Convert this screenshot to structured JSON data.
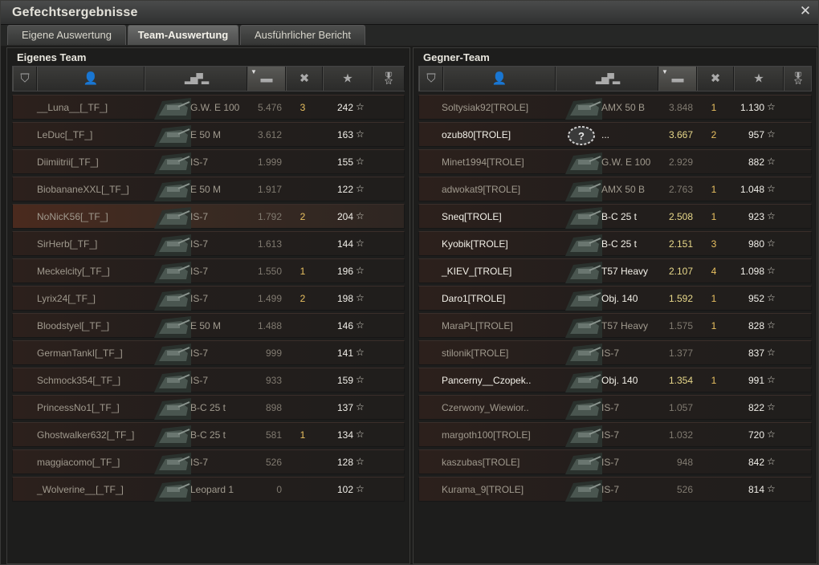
{
  "window": {
    "title": "Gefechtsergebnisse",
    "close_glyph": "✕"
  },
  "tabs": [
    {
      "label": "Eigene Auswertung",
      "active": false
    },
    {
      "label": "Team-Auswertung",
      "active": true
    },
    {
      "label": "Ausführlicher Bericht",
      "active": false
    }
  ],
  "left": {
    "title": "Eigenes Team",
    "rows": [
      {
        "player": "__Luna__[_TF_]",
        "vehicle": "G.W. E 100",
        "damage": "5.476",
        "frags": "3",
        "xp": "242",
        "alive": false,
        "hl": false
      },
      {
        "player": "LeDuc[_TF_]",
        "vehicle": "E 50 M",
        "damage": "3.612",
        "frags": "",
        "xp": "163",
        "alive": false,
        "hl": false
      },
      {
        "player": "Diimiitrii[_TF_]",
        "vehicle": "IS-7",
        "damage": "1.999",
        "frags": "",
        "xp": "155",
        "alive": false,
        "hl": false
      },
      {
        "player": "BiobananeXXL[_TF_]",
        "vehicle": "E 50 M",
        "damage": "1.917",
        "frags": "",
        "xp": "122",
        "alive": false,
        "hl": false
      },
      {
        "player": "NoNicK56[_TF_]",
        "vehicle": "IS-7",
        "damage": "1.792",
        "frags": "2",
        "xp": "204",
        "alive": false,
        "hl": true
      },
      {
        "player": "SirHerb[_TF_]",
        "vehicle": "IS-7",
        "damage": "1.613",
        "frags": "",
        "xp": "144",
        "alive": false,
        "hl": false
      },
      {
        "player": "Meckelcity[_TF_]",
        "vehicle": "IS-7",
        "damage": "1.550",
        "frags": "1",
        "xp": "196",
        "alive": false,
        "hl": false
      },
      {
        "player": "Lyrix24[_TF_]",
        "vehicle": "IS-7",
        "damage": "1.499",
        "frags": "2",
        "xp": "198",
        "alive": false,
        "hl": false
      },
      {
        "player": "Bloodstyel[_TF_]",
        "vehicle": "E 50 M",
        "damage": "1.488",
        "frags": "",
        "xp": "146",
        "alive": false,
        "hl": false
      },
      {
        "player": "GermanTankI[_TF_]",
        "vehicle": "IS-7",
        "damage": "999",
        "frags": "",
        "xp": "141",
        "alive": false,
        "hl": false
      },
      {
        "player": "Schmock354[_TF_]",
        "vehicle": "IS-7",
        "damage": "933",
        "frags": "",
        "xp": "159",
        "alive": false,
        "hl": false
      },
      {
        "player": "PrincessNo1[_TF_]",
        "vehicle": "B-C 25 t",
        "damage": "898",
        "frags": "",
        "xp": "137",
        "alive": false,
        "hl": false
      },
      {
        "player": "Ghostwalker632[_TF_]",
        "vehicle": "B-C 25 t",
        "damage": "581",
        "frags": "1",
        "xp": "134",
        "alive": false,
        "hl": false
      },
      {
        "player": "maggiacomo[_TF_]",
        "vehicle": "IS-7",
        "damage": "526",
        "frags": "",
        "xp": "128",
        "alive": false,
        "hl": false
      },
      {
        "player": "_Wolverine__[_TF_]",
        "vehicle": "Leopard 1",
        "damage": "0",
        "frags": "",
        "xp": "102",
        "alive": false,
        "hl": false
      }
    ]
  },
  "right": {
    "title": "Gegner-Team",
    "rows": [
      {
        "player": "Soltysiak92[TROLE]",
        "vehicle": "AMX 50 B",
        "damage": "3.848",
        "frags": "1",
        "xp": "1.130",
        "alive": false,
        "hl": false
      },
      {
        "player": "ozub80[TROLE]",
        "vehicle": "...",
        "damage": "3.667",
        "frags": "2",
        "xp": "957",
        "alive": true,
        "hl": false,
        "unknown": true
      },
      {
        "player": "Minet1994[TROLE]",
        "vehicle": "G.W. E 100",
        "damage": "2.929",
        "frags": "",
        "xp": "882",
        "alive": false,
        "hl": false
      },
      {
        "player": "adwokat9[TROLE]",
        "vehicle": "AMX 50 B",
        "damage": "2.763",
        "frags": "1",
        "xp": "1.048",
        "alive": false,
        "hl": false
      },
      {
        "player": "Sneq[TROLE]",
        "vehicle": "B-C 25 t",
        "damage": "2.508",
        "frags": "1",
        "xp": "923",
        "alive": true,
        "hl": false
      },
      {
        "player": "Kyobik[TROLE]",
        "vehicle": "B-C 25 t",
        "damage": "2.151",
        "frags": "3",
        "xp": "980",
        "alive": true,
        "hl": false
      },
      {
        "player": "_KIEV_[TROLE]",
        "vehicle": "T57 Heavy",
        "damage": "2.107",
        "frags": "4",
        "xp": "1.098",
        "alive": true,
        "hl": false
      },
      {
        "player": "Daro1[TROLE]",
        "vehicle": "Obj. 140",
        "damage": "1.592",
        "frags": "1",
        "xp": "952",
        "alive": true,
        "hl": false
      },
      {
        "player": "MaraPL[TROLE]",
        "vehicle": "T57 Heavy",
        "damage": "1.575",
        "frags": "1",
        "xp": "828",
        "alive": false,
        "hl": false
      },
      {
        "player": "stilonik[TROLE]",
        "vehicle": "IS-7",
        "damage": "1.377",
        "frags": "",
        "xp": "837",
        "alive": false,
        "hl": false
      },
      {
        "player": "Pancerny__Czopek..",
        "vehicle": "Obj. 140",
        "damage": "1.354",
        "frags": "1",
        "xp": "991",
        "alive": true,
        "hl": false
      },
      {
        "player": "Czerwony_Wiewior..",
        "vehicle": "IS-7",
        "damage": "1.057",
        "frags": "",
        "xp": "822",
        "alive": false,
        "hl": false
      },
      {
        "player": "margoth100[TROLE]",
        "vehicle": "IS-7",
        "damage": "1.032",
        "frags": "",
        "xp": "720",
        "alive": false,
        "hl": false
      },
      {
        "player": "kaszubas[TROLE]",
        "vehicle": "IS-7",
        "damage": "948",
        "frags": "",
        "xp": "842",
        "alive": false,
        "hl": false
      },
      {
        "player": "Kurama_9[TROLE]",
        "vehicle": "IS-7",
        "damage": "526",
        "frags": "",
        "xp": "814",
        "alive": false,
        "hl": false
      }
    ]
  },
  "glyphs": {
    "star": "☆",
    "sort": "▼"
  }
}
